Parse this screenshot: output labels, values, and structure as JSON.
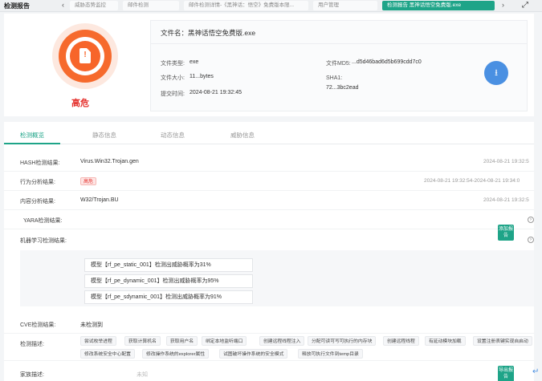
{
  "app": {
    "title": "检测报告"
  },
  "tabs": [
    {
      "label": "威胁态势监控"
    },
    {
      "label": "邮件检测"
    },
    {
      "label": "邮件检测详情-《黑神话：悟空》免费版本限..."
    },
    {
      "label": "用户管理"
    },
    {
      "label": "检测报告 黑神话悟空免费版.exe"
    }
  ],
  "risk": {
    "label": "高危",
    "color": "#f7652a"
  },
  "file": {
    "name": "文件名：黑神话悟空免费版.exe",
    "type_label": "文件类型:",
    "type_value": "exe",
    "size_label": "文件大小:",
    "size_value": "11...bytes",
    "submit_label": "提交时间:",
    "submit_value": "2024-08-21 19:32:45",
    "md5_label": "文件MD5:",
    "md5_value": "...d5d46bad6d5b699cdd7c0",
    "sha1_label": "SHA1:",
    "sha1_value": "72...3bc2ead"
  },
  "subtabs": [
    {
      "label": "检测概览"
    },
    {
      "label": "静态信息"
    },
    {
      "label": "动态信息"
    },
    {
      "label": "威胁信息"
    }
  ],
  "rows": [
    {
      "label": "HASH检测结果:",
      "value": "Virus.Win32.Trojan.gen",
      "time": "2024-08-21 19:32:5"
    },
    {
      "label": "行为分析结果:",
      "badge": "高危",
      "time": "2024-08-21 19:32:54-2024-08-21 19:34:0"
    },
    {
      "label": "内容分析结果:",
      "value": "W32/Trojan.BU",
      "time": "2024-08-21 19:32:5"
    },
    {
      "label": "YARA检测结果:"
    },
    {
      "label": "机器学习检测结果:"
    }
  ],
  "ml_results": [
    "模型【rf_pe_static_001】检测出威胁概率为31%",
    "模型【rf_pe_dynamic_001】检测出威胁概率为95%",
    "模型【rf_pe_sdynamic_001】检测出威胁概率为91%"
  ],
  "cve": {
    "label": "CVE检测结果:",
    "value": "未检测到"
  },
  "detect_desc": {
    "label": "检测描述:",
    "chips_row1": [
      "尝试枚举进程",
      "获取计算机名",
      "获取用户名",
      "绑定本地监听端口",
      "创建远程线程注入",
      "分配可读可写可执行的内存块",
      "创建远程线程",
      "有延动模块加载",
      "设置注册表键实现自启动"
    ],
    "chips_row2": [
      "修改系统安全中心配置",
      "修改操作系统的explorer属性",
      "试图破坏操作系统的安全模式",
      "释放可执行文件到temp目录"
    ]
  },
  "family": {
    "label": "家族描述:",
    "value": "未知"
  },
  "buttons": {
    "gen_report": "添加报告",
    "export_report": "导出报告"
  }
}
